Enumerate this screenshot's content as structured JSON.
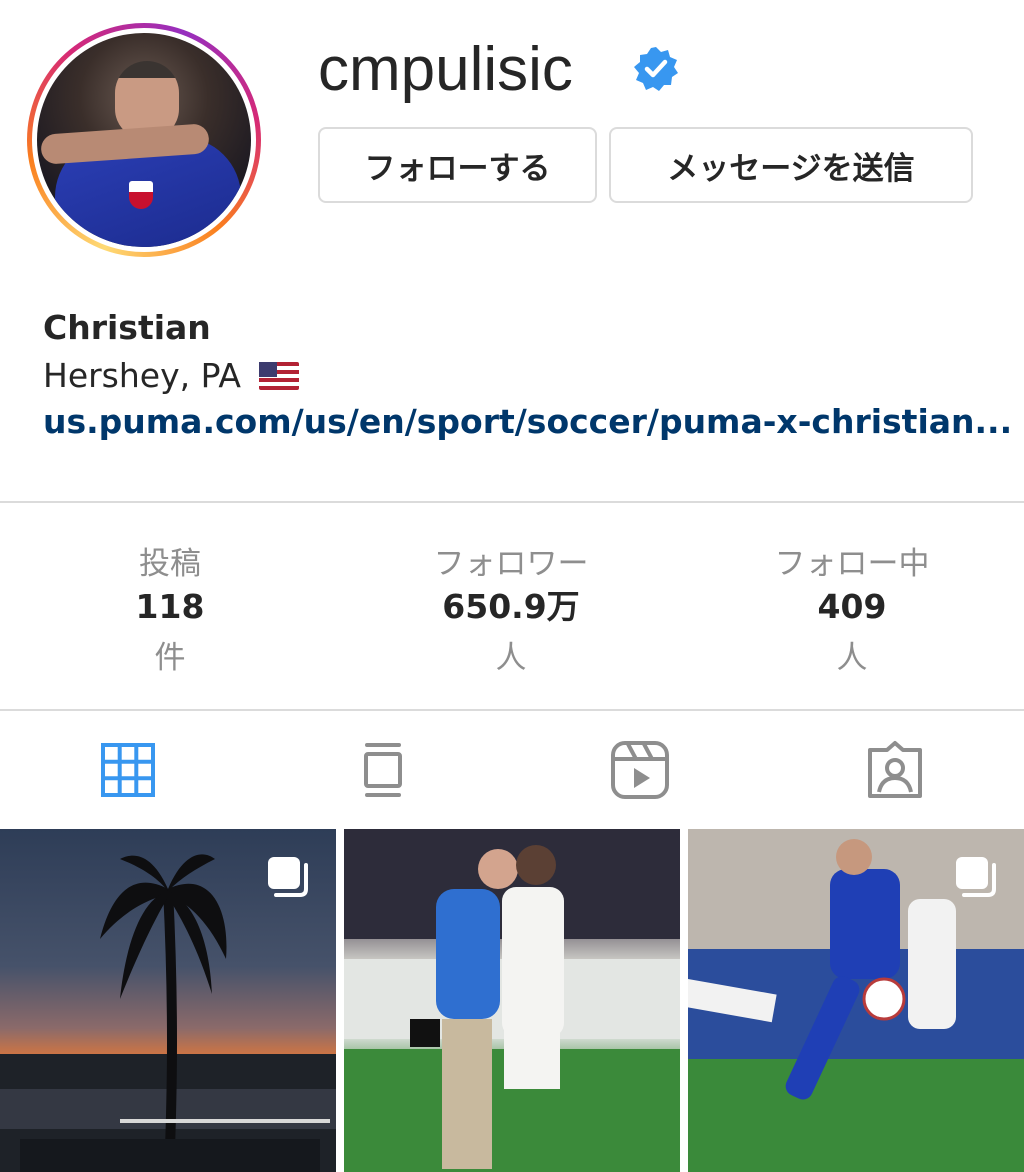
{
  "profile": {
    "username": "cmpulisic",
    "verified": true,
    "follow_label": "フォローする",
    "message_label": "メッセージを送信"
  },
  "bio": {
    "name": "Christian",
    "location": "Hershey, PA",
    "location_flag": "us-flag",
    "link": "us.puma.com/us/en/sport/soccer/puma-x-christian..."
  },
  "stats": [
    {
      "label": "投稿",
      "value": "118",
      "unit": "件"
    },
    {
      "label": "フォロワー",
      "value": "650.9万",
      "unit": "人"
    },
    {
      "label": "フォロー中",
      "value": "409",
      "unit": "人"
    }
  ],
  "tabs": [
    {
      "icon": "grid-icon",
      "active": true
    },
    {
      "icon": "guide-icon",
      "active": false
    },
    {
      "icon": "reels-icon",
      "active": false
    },
    {
      "icon": "tagged-icon",
      "active": false
    }
  ],
  "colors": {
    "accent": "#0095f6",
    "link": "#00376b",
    "active_tab": "#3897f0",
    "inactive_tab": "#8e8e8e",
    "border": "#dbdbdb"
  },
  "posts": [
    {
      "icon": "multiple-posts-icon"
    },
    {
      "icon": null
    },
    {
      "icon": "multiple-posts-icon"
    }
  ]
}
